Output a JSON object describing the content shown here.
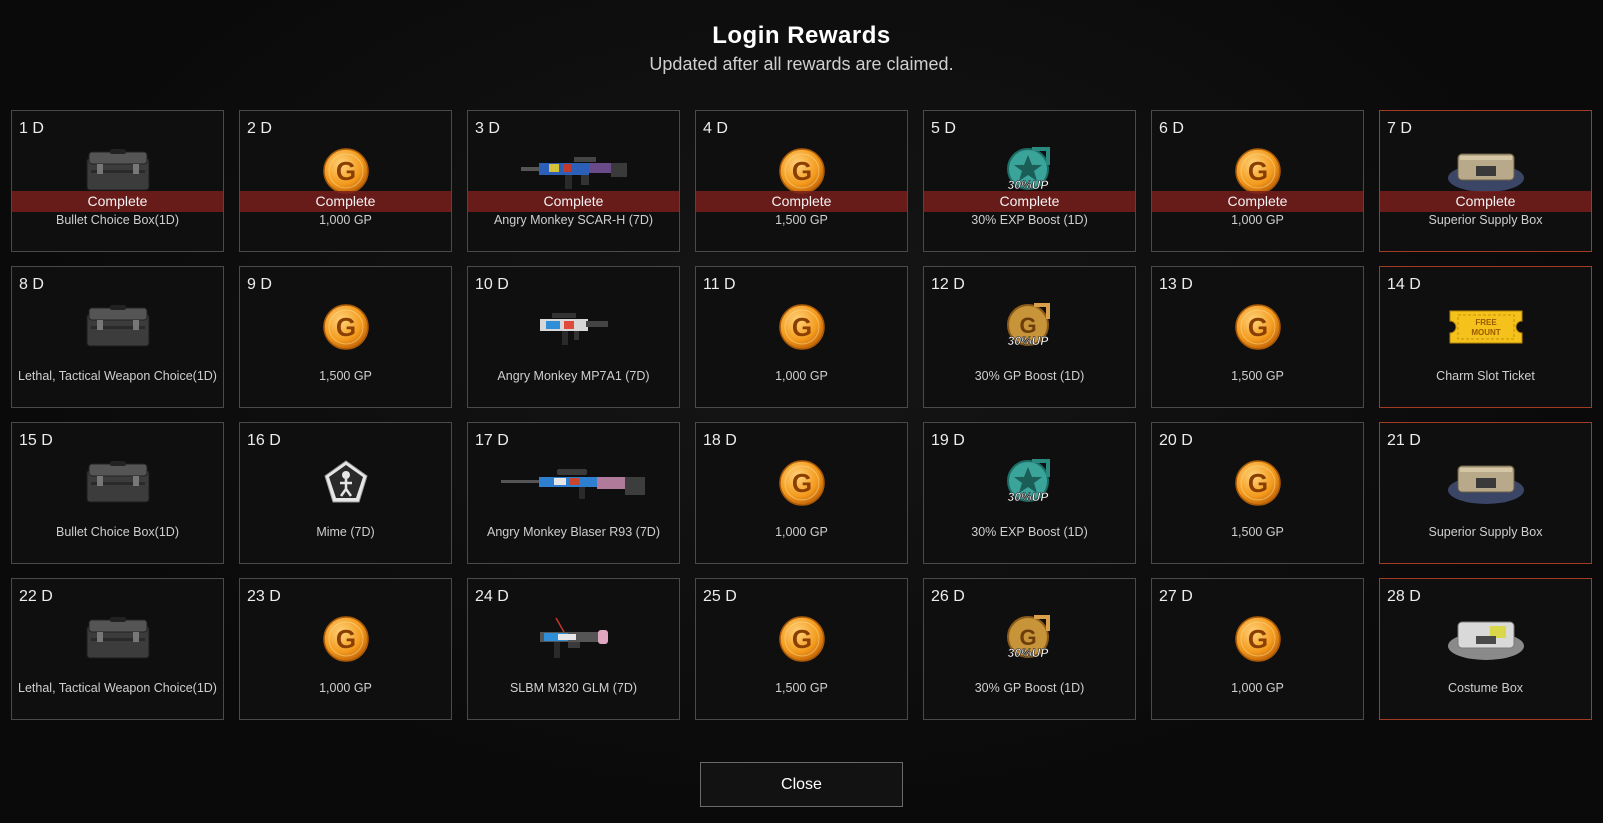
{
  "header": {
    "title": "Login Rewards",
    "subtitle": "Updated after all rewards are claimed."
  },
  "complete_label": "Complete",
  "close_label": "Close",
  "rewards": [
    {
      "day": "1 D",
      "name": "Bullet Choice Box(1D)",
      "icon": "crate-icon",
      "complete": true,
      "special": false
    },
    {
      "day": "2 D",
      "name": "1,000 GP",
      "icon": "gp-coin-icon",
      "complete": true,
      "special": false
    },
    {
      "day": "3 D",
      "name": "Angry Monkey SCAR-H (7D)",
      "icon": "rifle-icon",
      "complete": true,
      "special": false
    },
    {
      "day": "4 D",
      "name": "1,500 GP",
      "icon": "gp-coin-icon",
      "complete": true,
      "special": false
    },
    {
      "day": "5 D",
      "name": "30% EXP Boost (1D)",
      "icon": "exp-boost-icon",
      "complete": true,
      "special": false
    },
    {
      "day": "6 D",
      "name": "1,000 GP",
      "icon": "gp-coin-icon",
      "complete": true,
      "special": false
    },
    {
      "day": "7 D",
      "name": "Superior Supply Box",
      "icon": "supply-box-icon",
      "complete": true,
      "special": true
    },
    {
      "day": "8 D",
      "name": "Lethal, Tactical Weapon Choice(1D)",
      "icon": "crate-icon",
      "complete": false,
      "special": false
    },
    {
      "day": "9 D",
      "name": "1,500 GP",
      "icon": "gp-coin-icon",
      "complete": false,
      "special": false
    },
    {
      "day": "10 D",
      "name": "Angry Monkey MP7A1 (7D)",
      "icon": "smg-icon",
      "complete": false,
      "special": false
    },
    {
      "day": "11 D",
      "name": "1,000 GP",
      "icon": "gp-coin-icon",
      "complete": false,
      "special": false
    },
    {
      "day": "12 D",
      "name": "30% GP Boost (1D)",
      "icon": "gp-boost-icon",
      "complete": false,
      "special": false
    },
    {
      "day": "13 D",
      "name": "1,500 GP",
      "icon": "gp-coin-icon",
      "complete": false,
      "special": false
    },
    {
      "day": "14 D",
      "name": "Charm Slot Ticket",
      "icon": "ticket-icon",
      "complete": false,
      "special": true
    },
    {
      "day": "15 D",
      "name": "Bullet Choice Box(1D)",
      "icon": "crate-icon",
      "complete": false,
      "special": false
    },
    {
      "day": "16 D",
      "name": "Mime (7D)",
      "icon": "mime-icon",
      "complete": false,
      "special": false
    },
    {
      "day": "17 D",
      "name": "Angry Monkey Blaser R93 (7D)",
      "icon": "sniper-icon",
      "complete": false,
      "special": false
    },
    {
      "day": "18 D",
      "name": "1,000 GP",
      "icon": "gp-coin-icon",
      "complete": false,
      "special": false
    },
    {
      "day": "19 D",
      "name": "30% EXP Boost (1D)",
      "icon": "exp-boost-icon",
      "complete": false,
      "special": false
    },
    {
      "day": "20 D",
      "name": "1,500 GP",
      "icon": "gp-coin-icon",
      "complete": false,
      "special": false
    },
    {
      "day": "21 D",
      "name": "Superior Supply Box",
      "icon": "supply-box-icon",
      "complete": false,
      "special": true
    },
    {
      "day": "22 D",
      "name": "Lethal, Tactical Weapon Choice(1D)",
      "icon": "crate-icon",
      "complete": false,
      "special": false
    },
    {
      "day": "23 D",
      "name": "1,000 GP",
      "icon": "gp-coin-icon",
      "complete": false,
      "special": false
    },
    {
      "day": "24 D",
      "name": "SLBM M320 GLM (7D)",
      "icon": "launcher-icon",
      "complete": false,
      "special": false
    },
    {
      "day": "25 D",
      "name": "1,500 GP",
      "icon": "gp-coin-icon",
      "complete": false,
      "special": false
    },
    {
      "day": "26 D",
      "name": "30% GP Boost (1D)",
      "icon": "gp-boost-icon",
      "complete": false,
      "special": false
    },
    {
      "day": "27 D",
      "name": "1,000 GP",
      "icon": "gp-coin-icon",
      "complete": false,
      "special": false
    },
    {
      "day": "28 D",
      "name": "Costume Box",
      "icon": "costume-box-icon",
      "complete": false,
      "special": true
    }
  ],
  "icon_text": {
    "gp_letter": "G",
    "boost_label": "30%UP",
    "ticket_label": "FREE MOUNT"
  },
  "colors": {
    "complete_bar": "#781e1c",
    "special_border": "#a23b25",
    "gp_coin": "#f0a030"
  }
}
